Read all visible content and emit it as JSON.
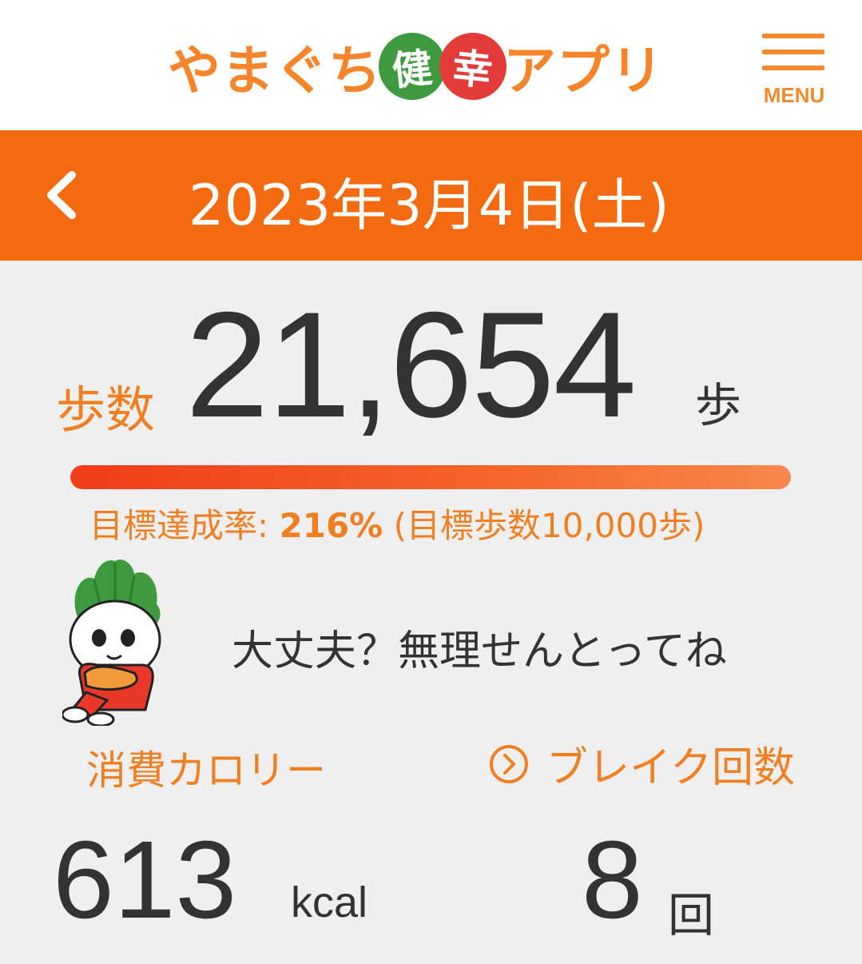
{
  "header": {
    "logo": {
      "part1": "やまぐち",
      "badge1": "健",
      "badge2": "幸",
      "part2": "アプリ"
    },
    "menu_label": "MENU"
  },
  "datebar": {
    "date": "2023年3月4日(土)"
  },
  "steps": {
    "label": "歩数",
    "value": "21,654",
    "unit": "歩",
    "progress_fraction": 1.0,
    "goal_prefix": "目標達成率: ",
    "goal_percent": "216%",
    "goal_suffix": " (目標歩数10,000歩)"
  },
  "message": "大丈夫？無理せんとってね",
  "stats": {
    "calorie_label": "消費カロリー",
    "calorie_value": "613",
    "calorie_unit": "kcal",
    "break_label": "ブレイク回数",
    "break_value": "8",
    "break_unit": "回"
  },
  "colors": {
    "accent": "#f46a10",
    "label_orange": "#f07f22",
    "text_dark": "#333333"
  },
  "icons": {
    "menu": "hamburger-icon",
    "back": "chevron-left-icon",
    "break_link": "chevron-right-circle-icon"
  }
}
